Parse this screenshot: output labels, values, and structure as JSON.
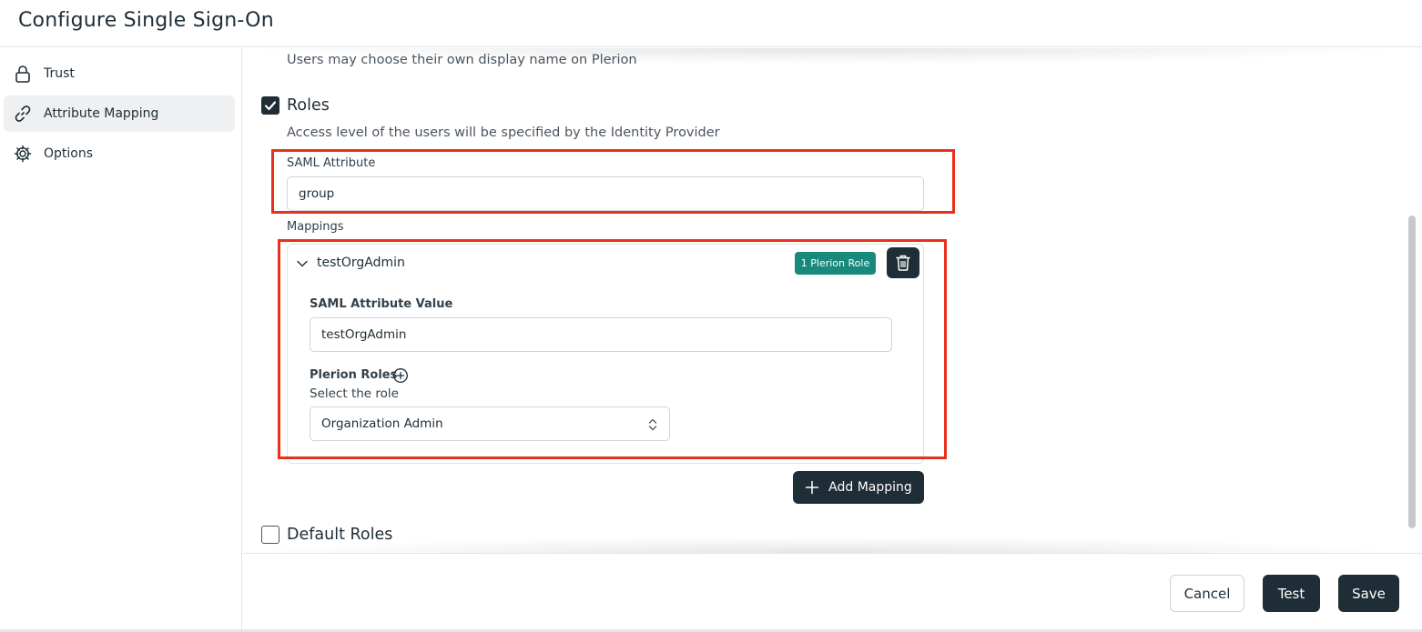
{
  "header": {
    "title": "Configure Single Sign-On"
  },
  "sidebar": {
    "items": [
      {
        "label": "Trust",
        "icon": "lock-icon",
        "active": false
      },
      {
        "label": "Attribute Mapping",
        "icon": "link-icon",
        "active": true
      },
      {
        "label": "Options",
        "icon": "gear-icon",
        "active": false
      }
    ]
  },
  "main": {
    "display_name_description": "Users may choose their own display name on Plerion",
    "roles": {
      "checked": true,
      "title": "Roles",
      "description": "Access level of the users will be specified by the Identity Provider",
      "saml_attribute_label": "SAML Attribute",
      "saml_attribute_value": "group",
      "mappings_label": "Mappings",
      "mapping": {
        "name": "testOrgAdmin",
        "badge": "1 Plerion Role",
        "value_label": "SAML Attribute Value",
        "value": "testOrgAdmin",
        "roles_label": "Plerion Roles",
        "select_label": "Select the role",
        "selected_role": "Organization Admin"
      },
      "add_mapping_label": "Add Mapping"
    },
    "default_roles": {
      "checked": false,
      "title": "Default Roles"
    }
  },
  "footer": {
    "cancel_label": "Cancel",
    "test_label": "Test",
    "save_label": "Save"
  },
  "colors": {
    "dark": "#1f2d36",
    "badge": "#178a7c",
    "highlight": "#e8301d"
  }
}
